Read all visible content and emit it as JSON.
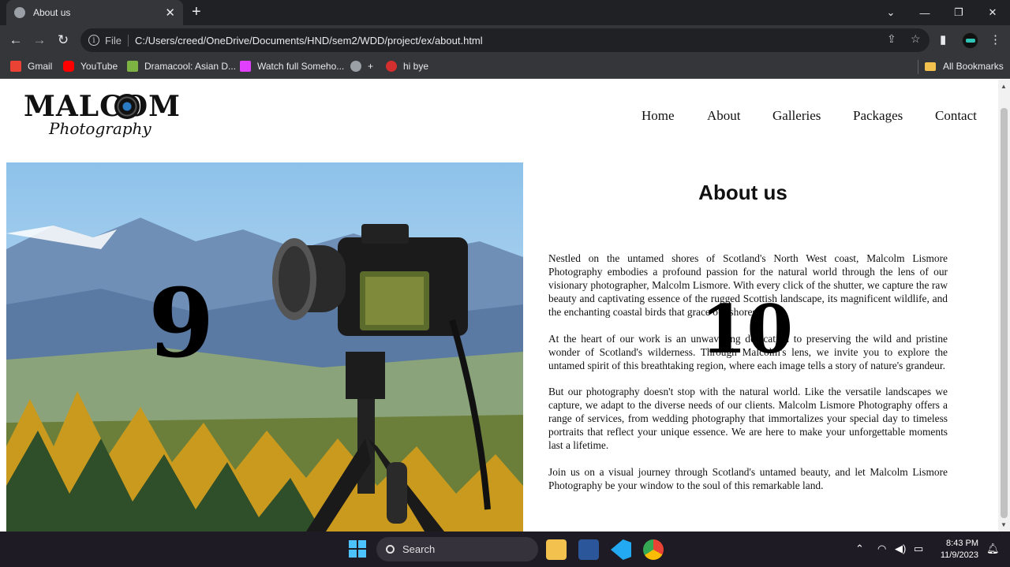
{
  "browser": {
    "tab_title": "About us",
    "tab_close": "✕",
    "new_tab": "+",
    "file_label": "File",
    "url": "C:/Users/creed/OneDrive/Documents/HND/sem2/WDD/project/ex/about.html",
    "bookmarks": [
      {
        "label": "Gmail",
        "color": "#ea4335"
      },
      {
        "label": "YouTube",
        "color": "#ff0000"
      },
      {
        "label": "Dramacool: Asian D...",
        "color": "#7cb342"
      },
      {
        "label": "Watch full Someho...",
        "color": "#e040fb"
      },
      {
        "label": "+",
        "color": "#9aa0a6"
      },
      {
        "label": "hi bye",
        "color": "#d32f2f"
      }
    ],
    "all_bookmarks": "All Bookmarks"
  },
  "site": {
    "logo_main": "MALCOM",
    "logo_sub": "Photography",
    "nav": [
      "Home",
      "About",
      "Galleries",
      "Packages",
      "Contact"
    ],
    "heading": "About us",
    "paragraphs": [
      "Nestled on the untamed shores of Scotland's North West coast, Malcolm Lismore Photography embodies a profound passion for the natural world through the lens of our visionary photographer, Malcolm Lismore. With every click of the shutter, we capture the raw beauty and captivating essence of the rugged Scottish landscape, its magnificent wildlife, and the enchanting coastal birds that grace our shores.",
      "At the heart of our work is an unwavering dedication to preserving the wild and pristine wonder of Scotland's wilderness. Through Malcolm's lens, we invite you to explore the untamed spirit of this breathtaking region, where each image tells a story of nature's grandeur.",
      "But our photography doesn't stop with the natural world. Like the versatile landscapes we capture, we adapt to the diverse needs of our clients. Malcolm Lismore Photography offers a range of services, from wedding photography that immortalizes your special day to timeless portraits that reflect your unique essence. We are here to make your unforgettable moments last a lifetime.",
      "Join us on a visual journey through Scotland's untamed beauty, and let Malcolm Lismore Photography be your window to the soul of this remarkable land."
    ],
    "overlay_numbers": [
      "9",
      "10"
    ]
  },
  "taskbar": {
    "search_label": "Search",
    "time": "8:43 PM",
    "date": "11/9/2023"
  }
}
